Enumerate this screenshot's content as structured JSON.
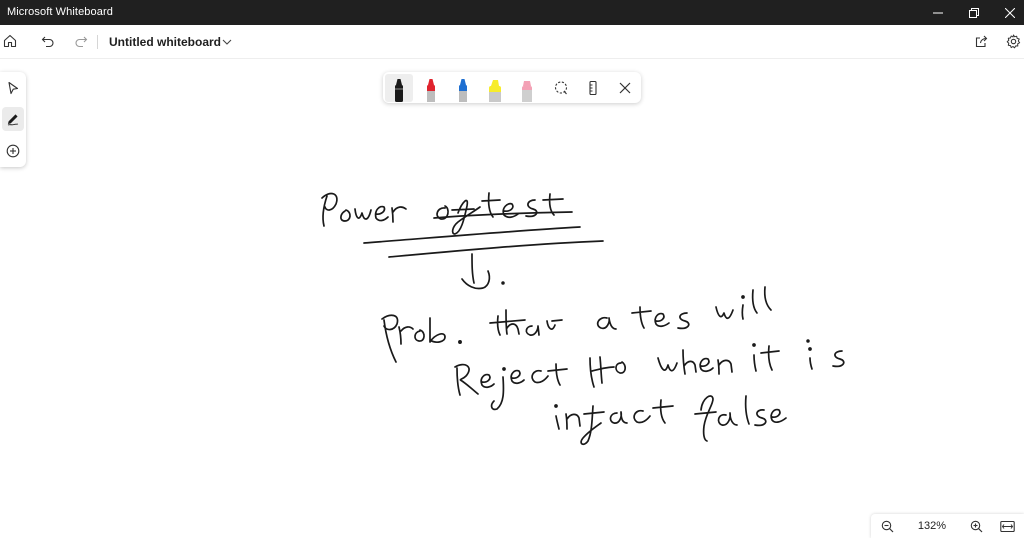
{
  "window": {
    "app_title": "Microsoft Whiteboard",
    "controls": [
      "minimize",
      "restore",
      "close"
    ]
  },
  "command_bar": {
    "icons": [
      "home-icon",
      "undo-icon",
      "redo-icon",
      "share-icon",
      "settings-icon"
    ],
    "document_title": "Untitled whiteboard"
  },
  "sidebar": {
    "items": [
      "select-tool",
      "pen-tool",
      "add-content"
    ],
    "active": "pen-tool"
  },
  "pen_toolbar": {
    "pens": [
      {
        "name": "pen-black",
        "color": "#1a1a1a",
        "selected": true
      },
      {
        "name": "pen-red",
        "color": "#e0232e",
        "selected": false
      },
      {
        "name": "pen-blue",
        "color": "#1e6fd1",
        "selected": false
      },
      {
        "name": "highlighter-yellow",
        "color": "#f7ec2a",
        "selected": false
      },
      {
        "name": "highlighter-pink",
        "color": "#f3a1b5",
        "selected": false
      }
    ],
    "tools": [
      "lasso-select-icon",
      "ruler-icon",
      "close-icon"
    ]
  },
  "zoom": {
    "level": "132%"
  },
  "colors": {
    "titlebar_bg": "#202020",
    "ink": "#1a1a1a",
    "canvas_bg": "#ffffff"
  }
}
